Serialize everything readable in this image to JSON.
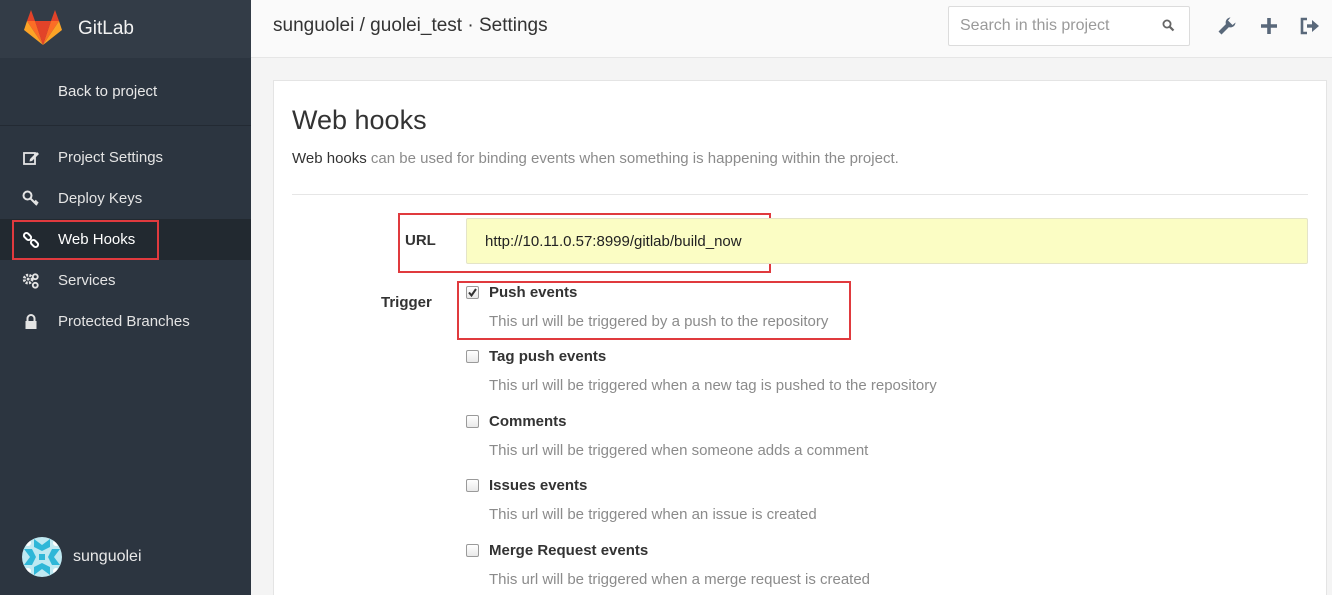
{
  "brand": {
    "name": "GitLab"
  },
  "sidebar": {
    "back_label": "Back to project",
    "items": [
      {
        "label": "Project Settings",
        "icon": "edit-icon"
      },
      {
        "label": "Deploy Keys",
        "icon": "key-icon"
      },
      {
        "label": "Web Hooks",
        "icon": "link-icon",
        "active": true
      },
      {
        "label": "Services",
        "icon": "cogs-icon"
      },
      {
        "label": "Protected Branches",
        "icon": "lock-icon"
      }
    ],
    "user": {
      "name": "sunguolei"
    }
  },
  "header": {
    "title": "sunguolei / guolei_test · Settings",
    "search_placeholder": "Search in this project"
  },
  "content": {
    "title": "Web hooks",
    "desc_strong": "Web hooks",
    "desc_rest": " can be used for binding events when something is happening within the project.",
    "url_label": "URL",
    "url_value": "http://10.11.0.57:8999/gitlab/build_now",
    "trigger_label": "Trigger",
    "events": [
      {
        "name": "Push events",
        "desc": "This url will be triggered by a push to the repository",
        "checked": true
      },
      {
        "name": "Tag push events",
        "desc": "This url will be triggered when a new tag is pushed to the repository",
        "checked": false
      },
      {
        "name": "Comments",
        "desc": "This url will be triggered when someone adds a comment",
        "checked": false
      },
      {
        "name": "Issues events",
        "desc": "This url will be triggered when an issue is created",
        "checked": false
      },
      {
        "name": "Merge Request events",
        "desc": "This url will be triggered when a merge request is created",
        "checked": false
      }
    ]
  },
  "colors": {
    "sidebar_bg": "#2c3540",
    "highlight_red": "#e03a3e",
    "url_bg": "#fbfdc4"
  }
}
